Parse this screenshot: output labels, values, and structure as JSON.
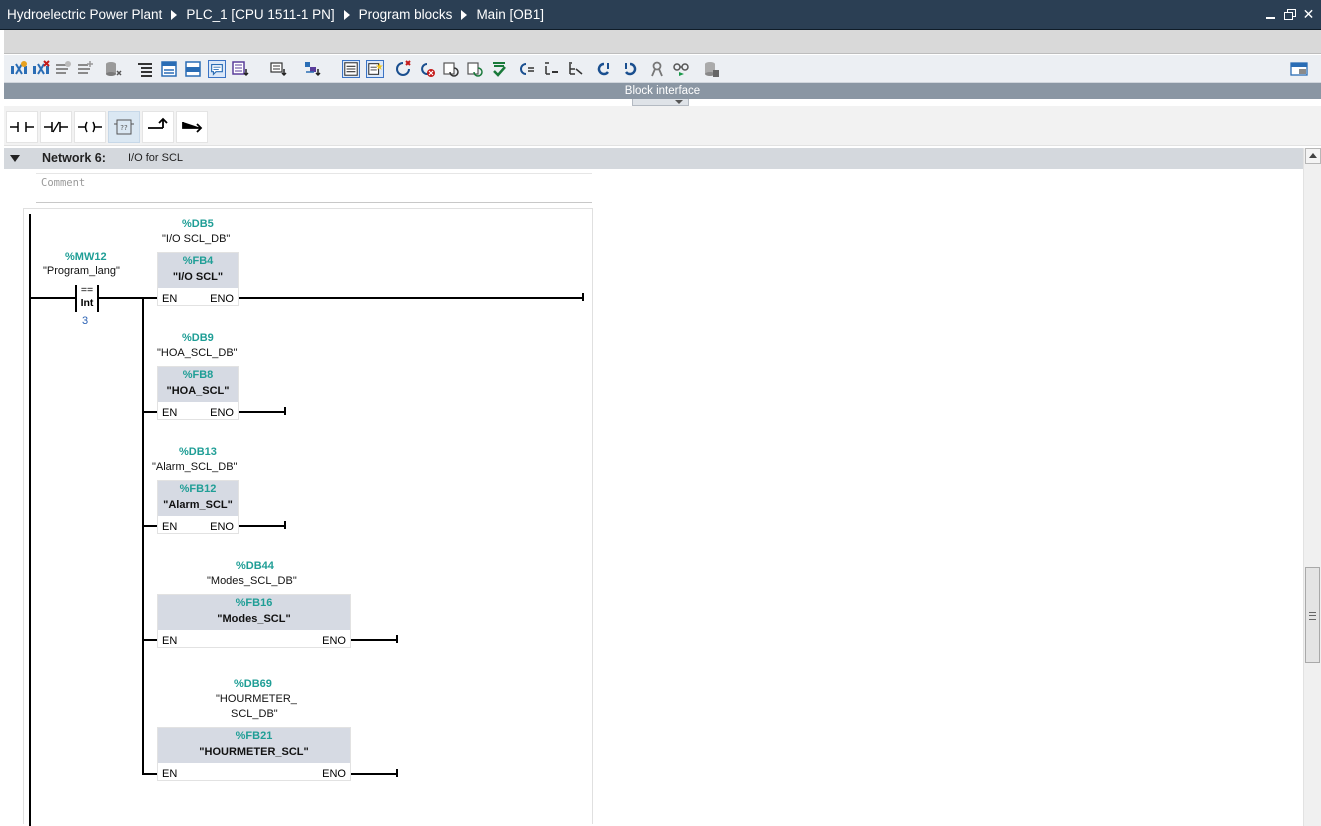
{
  "window": {
    "breadcrumb": [
      "Hydroelectric Power Plant",
      "PLC_1 [CPU 1511-1 PN]",
      "Program blocks",
      "Main [OB1]"
    ]
  },
  "toolbar": {
    "icons": [
      "insert-network-icon",
      "delete-network-icon",
      "insert-row-icon",
      "add-row-icon",
      "reset-start-values-icon",
      "absolute-operands-icon",
      "display-favorites-icon",
      "network-comments-icon",
      "show-comments-icon",
      "symbolic-info-icon",
      "operand-display-icon",
      "expand-networks-icon",
      "collapse-networks-icon",
      "open-all-icon",
      "close-all-icon",
      "go-to-error-icon",
      "previous-error-icon",
      "next-error-icon",
      "check-syntax-icon",
      "update-calls-icon",
      "compile-icon",
      "monitoring-icon",
      "modify-icon",
      "snapshot-icon",
      "status-icon"
    ],
    "right_icon": "block-interface-toggle-icon"
  },
  "block_interface": {
    "label": "Block interface"
  },
  "lad_elements": [
    "normally-open-contact",
    "normally-closed-contact",
    "output-coil",
    "empty-box",
    "open-branch",
    "close-branch"
  ],
  "network": {
    "title": "Network 6:",
    "description": "I/O for SCL",
    "comment_placeholder": "Comment"
  },
  "compare": {
    "address": "%MW12",
    "tag": "\"Program_lang\"",
    "op": "==",
    "type": "Int",
    "value": "3"
  },
  "blocks": [
    {
      "db_address": "%DB5",
      "db_name": "\"I/O SCL_DB\"",
      "fb_address": "%FB4",
      "fb_name": "\"I/O SCL\"",
      "en": "EN",
      "eno": "ENO"
    },
    {
      "db_address": "%DB9",
      "db_name": "\"HOA_SCL_DB\"",
      "fb_address": "%FB8",
      "fb_name": "\"HOA_SCL\"",
      "en": "EN",
      "eno": "ENO"
    },
    {
      "db_address": "%DB13",
      "db_name": "\"Alarm_SCL_DB\"",
      "fb_address": "%FB12",
      "fb_name": "\"Alarm_SCL\"",
      "en": "EN",
      "eno": "ENO"
    },
    {
      "db_address": "%DB44",
      "db_name": "\"Modes_SCL_DB\"",
      "fb_address": "%FB16",
      "fb_name": "\"Modes_SCL\"",
      "en": "EN",
      "eno": "ENO"
    },
    {
      "db_address": "%DB69",
      "db_name_line1": "\"HOURMETER_",
      "db_name_line2": "SCL_DB\"",
      "fb_address": "%FB21",
      "fb_name": "\"HOURMETER_SCL\"",
      "en": "EN",
      "eno": "ENO"
    }
  ]
}
